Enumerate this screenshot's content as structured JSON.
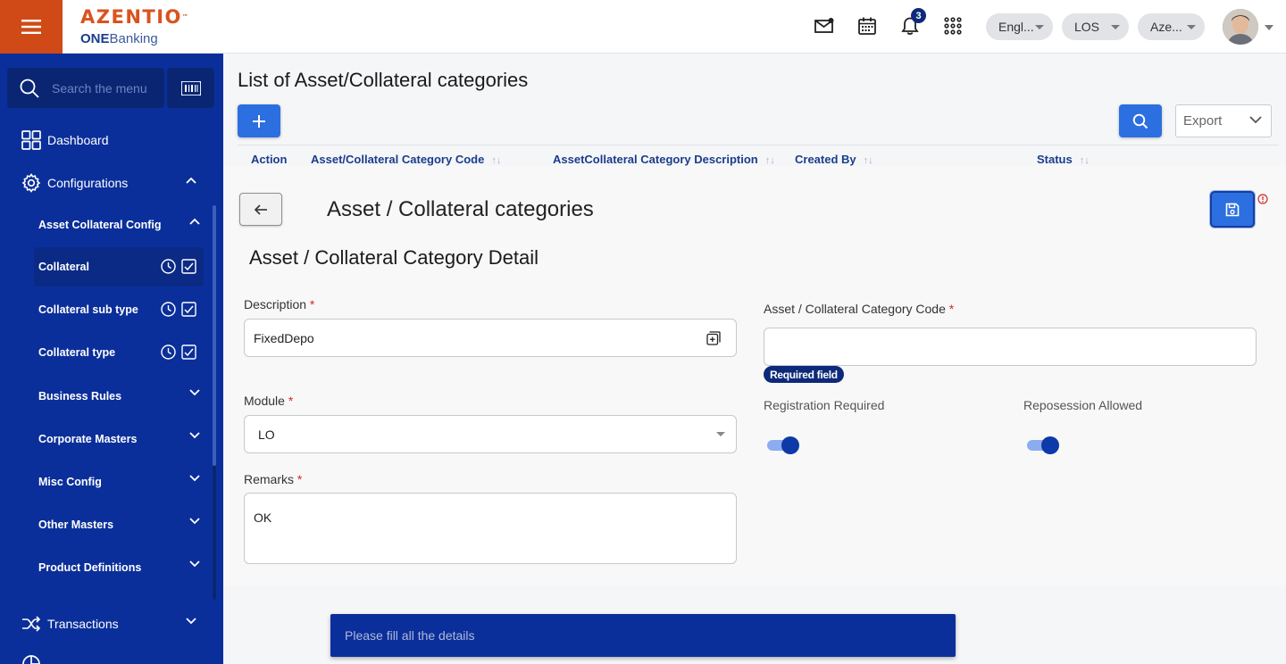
{
  "header": {
    "brand": "AZENTIO",
    "brand_mark": "™",
    "product_prefix": "ONE",
    "product_suffix": "Banking",
    "notification_count": "3",
    "language": "Engl...",
    "module": "LOS",
    "entity": "Aze..."
  },
  "sidebar": {
    "search_placeholder": "Search the menu",
    "dashboard": "Dashboard",
    "configurations": "Configurations",
    "asset_collateral_config": "Asset Collateral Config",
    "items": [
      {
        "label": "Collateral"
      },
      {
        "label": "Collateral sub type"
      },
      {
        "label": "Collateral type"
      },
      {
        "label": "Business Rules"
      },
      {
        "label": "Corporate Masters"
      },
      {
        "label": "Misc Config"
      },
      {
        "label": "Other Masters"
      },
      {
        "label": "Product Definitions"
      }
    ],
    "transactions": "Transactions"
  },
  "list_page": {
    "title": "List of Asset/Collateral categories",
    "export_label": "Export",
    "columns": [
      "Action",
      "Asset/Collateral Category Code",
      "AssetCollateral Category Description",
      "Created By",
      "Status"
    ]
  },
  "detail": {
    "title": "Asset / Collateral categories",
    "section_title": "Asset / Collateral Category Detail",
    "description_label": "Description",
    "description_value": "FixedDepo",
    "code_label": "Asset / Collateral Category Code",
    "code_value": "",
    "required_chip": "Required field",
    "module_label": "Module",
    "module_value": "LO",
    "remarks_label": "Remarks",
    "remarks_value": "OK",
    "registration_label": "Registration Required",
    "registration_on": true,
    "repossession_label": "Reposession Allowed",
    "repossession_on": true,
    "required_mark": "*"
  },
  "toast": {
    "message": "Please fill all the details"
  },
  "colors": {
    "sidebar_bg": "#0b2f9a",
    "hamburger_bg": "#cf4a16",
    "primary_button": "#2c6fe0",
    "brand_orange": "#d9531e"
  }
}
